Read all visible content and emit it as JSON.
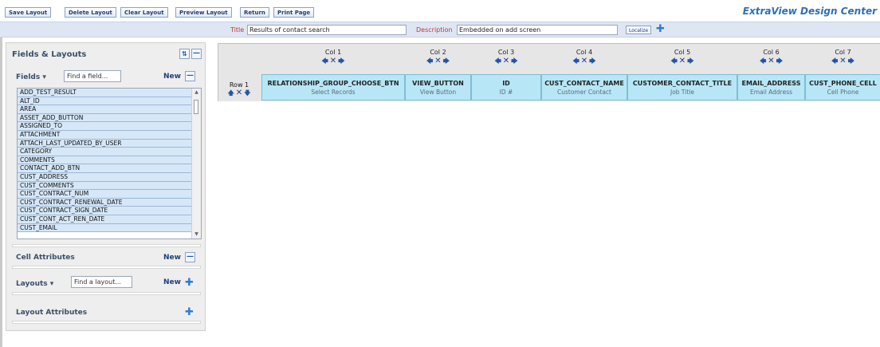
{
  "toolbar": {
    "buttons": [
      "Save Layout",
      "Delete Layout",
      "Clear Layout",
      "Preview Layout",
      "Return",
      "Print Page"
    ],
    "brand": "ExtraView Design Center"
  },
  "titlebar": {
    "title_label": "Title",
    "title_value": "Results of contact search",
    "description_label": "Description",
    "description_value": "Embedded on add screen",
    "localize_label": "Localize"
  },
  "left_panel": {
    "heading": "Fields & Layouts",
    "fields_label": "Fields ▾",
    "find_field_placeholder": "Find a field...",
    "new_label": "New",
    "fields": [
      "ADD_TEST_RESULT",
      "ALT_ID",
      "AREA",
      "ASSET_ADD_BUTTON",
      "ASSIGNED_TO",
      "ATTACHMENT",
      "ATTACH_LAST_UPDATED_BY_USER",
      "CATEGORY",
      "COMMENTS",
      "CONTACT_ADD_BTN",
      "CUST_ADDRESS",
      "CUST_COMMENTS",
      "CUST_CONTRACT_NUM",
      "CUST_CONTRACT_RENEWAL_DATE",
      "CUST_CONTRACT_SIGN_DATE",
      "CUST_CONT_ACT_REN_DATE",
      "CUST_EMAIL"
    ],
    "cell_attributes_label": "Cell Attributes",
    "layouts_label": "Layouts ▾",
    "find_layout_placeholder": "Find a layout...",
    "layout_attributes_label": "Layout Attributes"
  },
  "grid": {
    "columns": [
      {
        "title": "Col 1",
        "name": "RELATIONSHIP_GROUP_CHOOSE_BTN",
        "label": "Select Records"
      },
      {
        "title": "Col 2",
        "name": "VIEW_BUTTON",
        "label": "View Button"
      },
      {
        "title": "Col 3",
        "name": "ID",
        "label": "ID #"
      },
      {
        "title": "Col 4",
        "name": "CUST_CONTACT_NAME",
        "label": "Customer Contact"
      },
      {
        "title": "Col 5",
        "name": "CUSTOMER_CONTACT_TITLE",
        "label": "Job Title"
      },
      {
        "title": "Col 6",
        "name": "EMAIL_ADDRESS",
        "label": "Email Address"
      },
      {
        "title": "Col 7",
        "name": "CUST_PHONE_CELL",
        "label": "Cell Phone"
      }
    ],
    "row_label": "Row 1"
  },
  "colors": {
    "brand": "#2e6fb4",
    "cell_bg": "#b7e7f7",
    "field_item_bg": "#d6e7f7",
    "label_red": "#c0392b"
  }
}
